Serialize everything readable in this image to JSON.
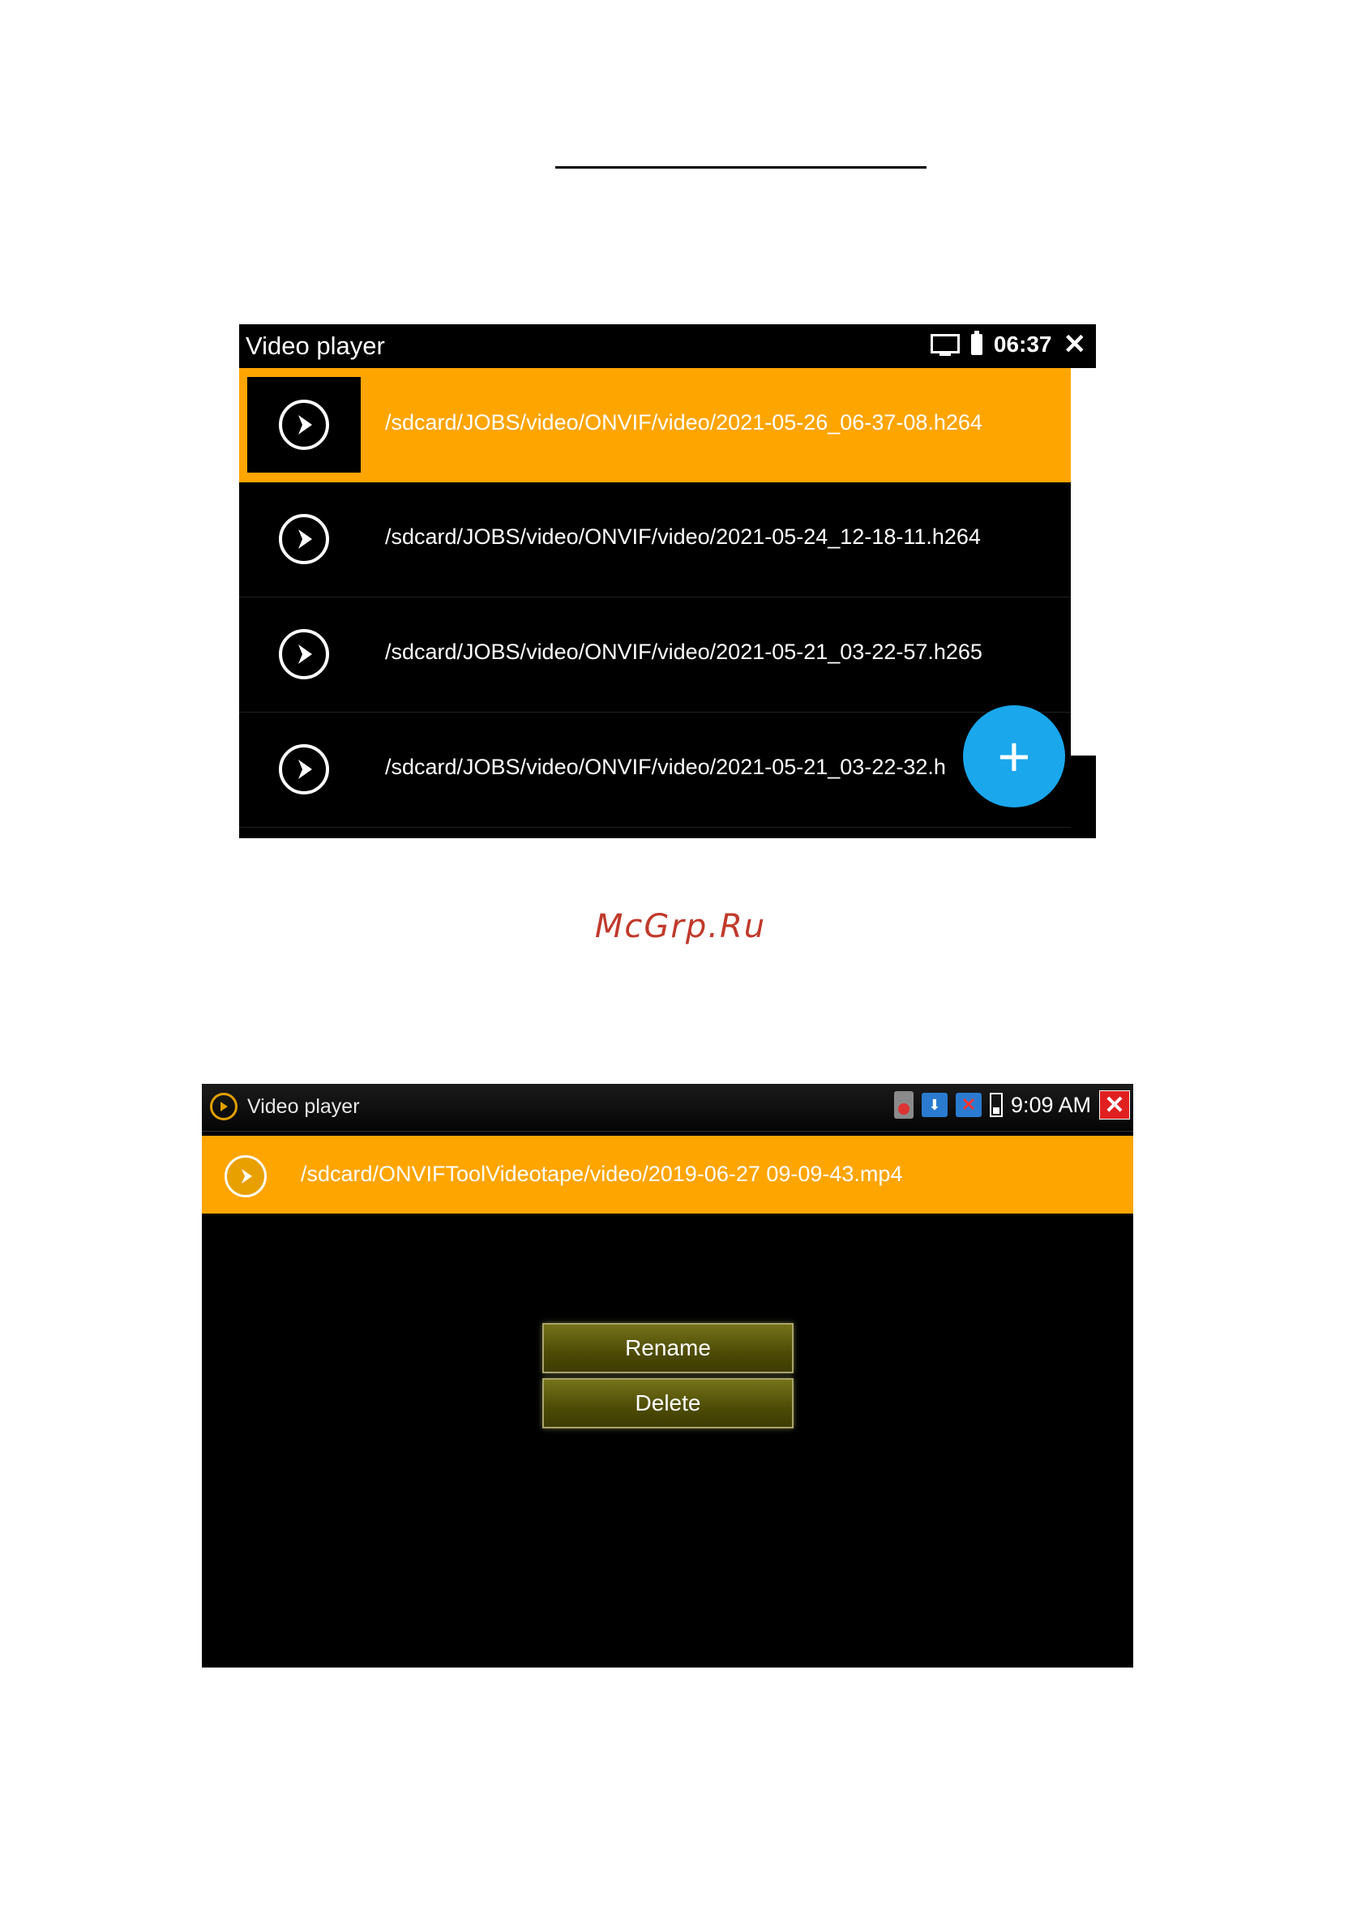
{
  "screenshot1": {
    "title": "Video player",
    "time": "06:37",
    "close_glyph": "✕",
    "files": [
      "/sdcard/JOBS/video/ONVIF/video/2021-05-26_06-37-08.h264",
      "/sdcard/JOBS/video/ONVIF/video/2021-05-24_12-18-11.h264",
      "/sdcard/JOBS/video/ONVIF/video/2021-05-21_03-22-57.h265",
      "/sdcard/JOBS/video/ONVIF/video/2021-05-21_03-22-32.h"
    ],
    "fab_label": "+",
    "icons": [
      "monitor-icon",
      "battery-icon",
      "close-icon",
      "play-icon",
      "add-icon"
    ]
  },
  "watermark": "McGrp.Ru",
  "screenshot2": {
    "title": "Video player",
    "time": "9:09 AM",
    "close_glyph": "✕",
    "selected_file": "/sdcard/ONVIFToolVideotape/video/2019-06-27 09-09-43.mp4",
    "menu": {
      "rename_label": "Rename",
      "delete_label": "Delete"
    },
    "icons": [
      "app-play-icon",
      "sd-card-icon",
      "download-icon",
      "network-error-icon",
      "battery-icon",
      "close-icon"
    ]
  },
  "colors": {
    "selected_row": "#ffa500",
    "fab": "#1aa7ec",
    "menu_button": "#4d4b05",
    "watermark": "#c0392b",
    "close_red": "#e02020"
  }
}
